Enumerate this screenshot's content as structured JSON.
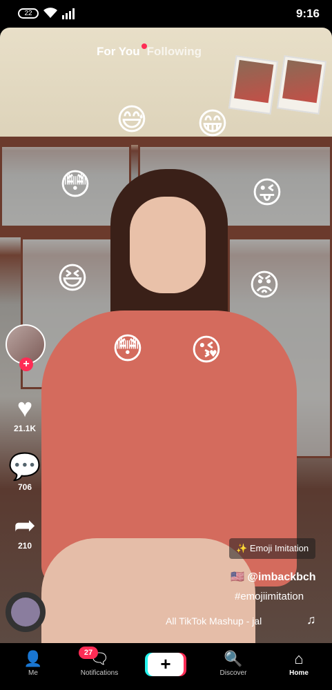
{
  "status_bar": {
    "time": "9:16",
    "battery": "22"
  },
  "feed_tabs": {
    "following": "Following",
    "for_you": "For You"
  },
  "creator": {
    "username": "@imbackbch",
    "flag": "🇺🇸",
    "caption_hashtag": "#emojiimitation",
    "effect": "Emoji Imitation",
    "sound": "All TikTok Mashup - jal"
  },
  "actions": {
    "likes": "21.1K",
    "comments": "706",
    "shares": "210"
  },
  "bottom_nav": {
    "home": "Home",
    "discover": "Discover",
    "notifications": "Notifications",
    "notifications_badge": "27",
    "me": "Me",
    "create": "+"
  },
  "icons": {
    "like": "heart-icon",
    "comment": "comment-icon",
    "share": "share-icon",
    "home": "home-icon",
    "discover": "search-icon",
    "notifications": "inbox-icon",
    "me": "profile-icon"
  },
  "colors": {
    "accent_red": "#fe2c55",
    "accent_cyan": "#25f4ee"
  }
}
